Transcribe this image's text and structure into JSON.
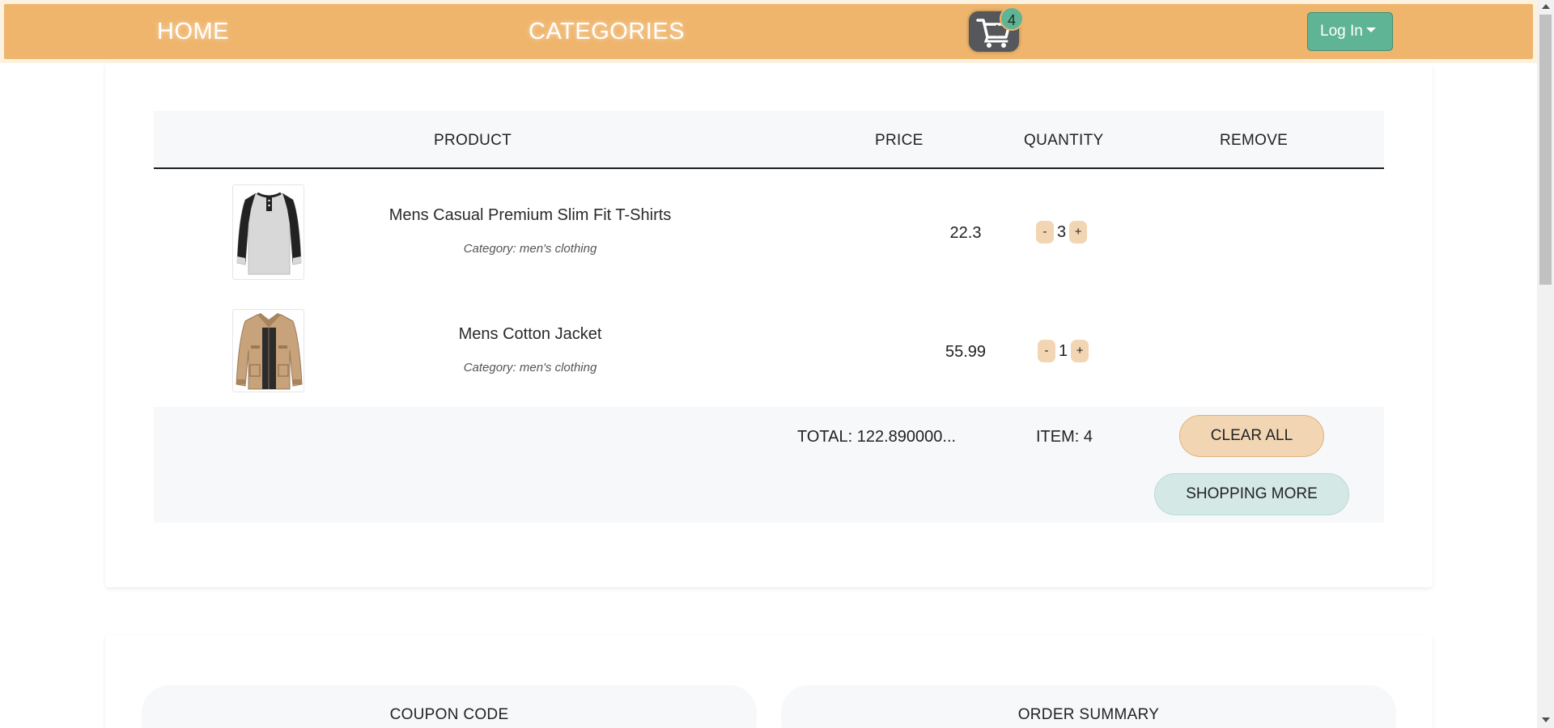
{
  "nav": {
    "home": "HOME",
    "categories": "CATEGORIES",
    "cart_count": "4",
    "login": "Log In"
  },
  "table": {
    "headers": {
      "product": "PRODUCT",
      "price": "PRICE",
      "quantity": "QUANTITY",
      "remove": "REMOVE"
    },
    "rows": [
      {
        "name": "Mens Casual Premium Slim Fit T-Shirts",
        "category": "Category: men's clothing",
        "price": "22.3",
        "quantity": "3",
        "minus": "-",
        "plus": "+",
        "image_icon": "raglan-tshirt-icon"
      },
      {
        "name": "Mens Cotton Jacket",
        "category": "Category: men's clothing",
        "price": "55.99",
        "quantity": "1",
        "minus": "-",
        "plus": "+",
        "image_icon": "cotton-jacket-icon"
      }
    ],
    "footer": {
      "total": "TOTAL: 122.890000...",
      "items": "ITEM: 4",
      "clear_all": "CLEAR ALL",
      "shopping_more": "SHOPPING MORE"
    }
  },
  "summary": {
    "coupon_title": "COUPON CODE",
    "order_title": "ORDER SUMMARY"
  },
  "colors": {
    "navbar": "#efb56c",
    "accent_green": "#5fb496",
    "step_button": "#f2d6b4",
    "shopping_more": "#d4e8e6"
  }
}
